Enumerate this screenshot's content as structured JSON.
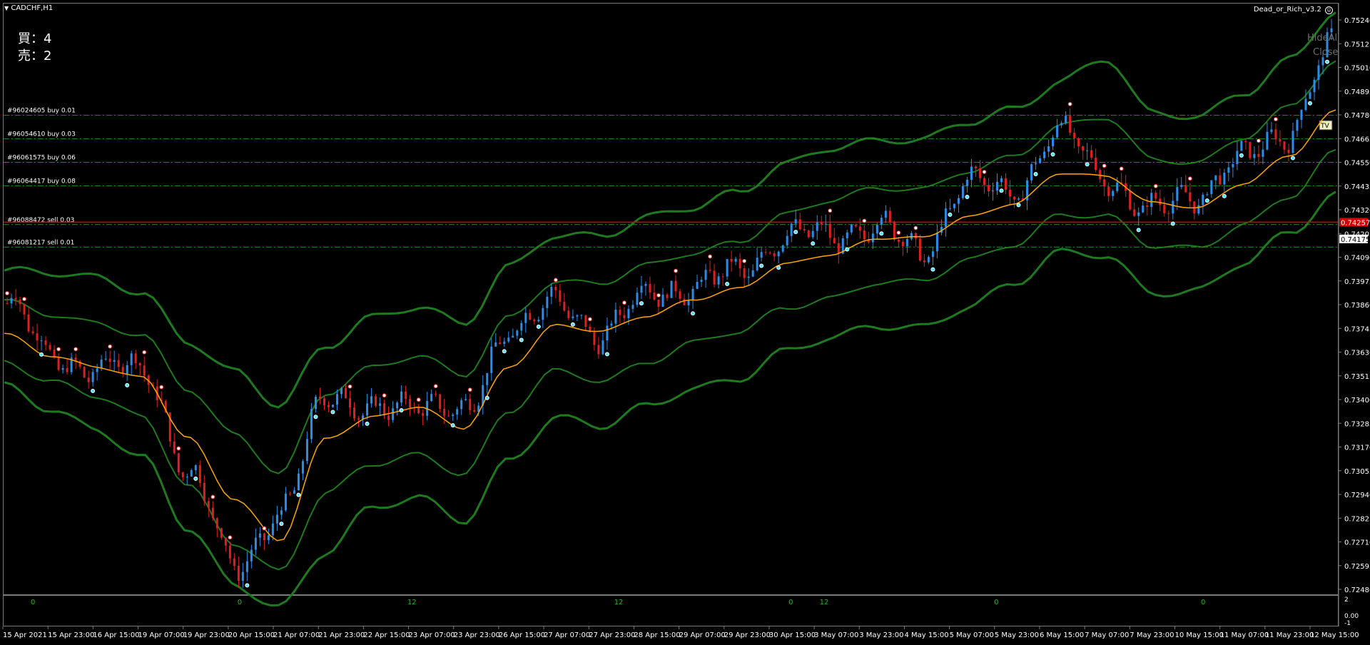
{
  "window": {
    "symbol_timeframe": "CADCHF,H1",
    "expert_name": "Dead_or_Rich_v3.2",
    "hide_button": "HideAll",
    "close_button": "Close"
  },
  "position_counts": {
    "buy_label": "買：4",
    "sell_label": "売：2"
  },
  "order_lines": [
    {
      "label": "#96024605 buy 0.01",
      "price": 0.7478,
      "color": "#1f8f1f"
    },
    {
      "label": "#96054610 buy 0.03",
      "price": 0.74665,
      "color": "#1f8f1f"
    },
    {
      "label": "#96061575 buy 0.06",
      "price": 0.7455,
      "color": "#1f8f1f"
    },
    {
      "label": "#96064417 buy 0.08",
      "price": 0.74435,
      "color": "#1f8f1f"
    },
    {
      "label": "#96088472 sell 0.03",
      "price": 0.74245,
      "color": "#1f8f1f"
    },
    {
      "label": "#96081217 sell 0.01",
      "price": 0.74135,
      "color": "#1f8f1f"
    }
  ],
  "current_price": {
    "label": "0.74257",
    "value": 0.74257,
    "color": "#d40000"
  },
  "second_price_tag": {
    "label": "0.74175",
    "value": 0.74175
  },
  "tag_box": {
    "label": "TV"
  },
  "price_axis": {
    "ticks": [
      "0.75240",
      "0.75125",
      "0.75010",
      "0.74895",
      "0.74780",
      "0.74665",
      "0.74550",
      "0.74435",
      "0.74320",
      "0.74205",
      "0.74090",
      "0.73975",
      "0.73860",
      "0.73745",
      "0.73630",
      "0.73515",
      "0.73400",
      "0.73285",
      "0.73170",
      "0.73055",
      "0.72940",
      "0.72825",
      "0.72710",
      "0.72595",
      "0.72480"
    ],
    "max": 0.7524,
    "min": 0.7248
  },
  "time_axis": {
    "labels": [
      "15 Apr 2021",
      "15 Apr 23:00",
      "16 Apr 15:00",
      "19 Apr 07:00",
      "19 Apr 23:00",
      "20 Apr 15:00",
      "21 Apr 07:00",
      "21 Apr 23:00",
      "22 Apr 15:00",
      "23 Apr 07:00",
      "23 Apr 23:00",
      "26 Apr 15:00",
      "27 Apr 07:00",
      "27 Apr 23:00",
      "28 Apr 15:00",
      "29 Apr 07:00",
      "29 Apr 23:00",
      "30 Apr 15:00",
      "3 May 07:00",
      "3 May 23:00",
      "4 May 15:00",
      "5 May 07:00",
      "5 May 23:00",
      "6 May 15:00",
      "7 May 07:00",
      "7 May 23:00",
      "10 May 15:00",
      "11 May 07:00",
      "11 May 23:00",
      "12 May 15:00"
    ]
  },
  "sub_window": {
    "axis_ticks": [
      "2",
      "0.00",
      "-1"
    ],
    "markers": [
      {
        "text": "0",
        "index": 0.022
      },
      {
        "text": "0",
        "index": 0.177
      },
      {
        "text": "12",
        "index": 0.306
      },
      {
        "text": "12",
        "index": 0.461
      },
      {
        "text": "0",
        "index": 0.59
      },
      {
        "text": "12",
        "index": 0.615
      },
      {
        "text": "0",
        "index": 0.744
      },
      {
        "text": "0",
        "index": 0.899
      }
    ],
    "marker_color": "#22b422"
  },
  "colors": {
    "background": "#000000",
    "bull_candle": "#2a8ee8",
    "bear_candle": "#e02020",
    "ma_line": "#ffa500",
    "band_line": "#1e7a1e",
    "order_line": "#1f8f1f",
    "grid_text": "#ffffff"
  },
  "chart_data": {
    "type": "line",
    "title": "CADCHF,H1",
    "xlabel": "",
    "ylabel": "",
    "ylim": [
      0.7248,
      0.7524
    ],
    "x": [
      "15 Apr 2021",
      "15 Apr 23:00",
      "16 Apr 15:00",
      "19 Apr 07:00",
      "19 Apr 23:00",
      "20 Apr 15:00",
      "21 Apr 07:00",
      "21 Apr 23:00",
      "22 Apr 15:00",
      "23 Apr 07:00",
      "23 Apr 23:00",
      "26 Apr 15:00",
      "27 Apr 07:00",
      "27 Apr 23:00",
      "28 Apr 15:00",
      "29 Apr 07:00",
      "29 Apr 23:00",
      "30 Apr 15:00",
      "3 May 07:00",
      "3 May 23:00",
      "4 May 15:00",
      "5 May 07:00",
      "5 May 23:00",
      "6 May 15:00",
      "7 May 07:00",
      "7 May 23:00",
      "10 May 15:00",
      "11 May 07:00",
      "11 May 23:00",
      "12 May 15:00"
    ],
    "series": [
      {
        "values": [
          0.7386,
          0.736,
          0.7353,
          0.7355,
          0.73,
          0.726,
          0.728,
          0.7345,
          0.733,
          0.734,
          0.733,
          0.7375,
          0.7385,
          0.7372,
          0.739,
          0.7395,
          0.74,
          0.742,
          0.7418,
          0.7425,
          0.741,
          0.7445,
          0.744,
          0.747,
          0.745,
          0.743,
          0.744,
          0.7455,
          0.747,
          0.751
        ]
      },
      {
        "values": [
          0.7371,
          0.736,
          0.7355,
          0.735,
          0.732,
          0.729,
          0.727,
          0.732,
          0.733,
          0.7335,
          0.7325,
          0.7355,
          0.7375,
          0.7372,
          0.738,
          0.7388,
          0.7393,
          0.7405,
          0.741,
          0.7418,
          0.7418,
          0.7428,
          0.7435,
          0.745,
          0.7448,
          0.7435,
          0.7433,
          0.7445,
          0.7458,
          0.748
        ]
      },
      {
        "values": [
          0.7402,
          0.74,
          0.7398,
          0.7392,
          0.7368,
          0.7352,
          0.7335,
          0.7365,
          0.738,
          0.7385,
          0.7375,
          0.7403,
          0.742,
          0.742,
          0.7428,
          0.7432,
          0.744,
          0.7455,
          0.7463,
          0.7465,
          0.7465,
          0.7475,
          0.7482,
          0.7495,
          0.7505,
          0.7478,
          0.7478,
          0.749,
          0.7505,
          0.7528
        ]
      },
      {
        "values": [
          0.7345,
          0.7335,
          0.7325,
          0.731,
          0.7275,
          0.7248,
          0.7238,
          0.7265,
          0.7285,
          0.729,
          0.728,
          0.731,
          0.733,
          0.7325,
          0.7335,
          0.7345,
          0.735,
          0.7362,
          0.7368,
          0.7375,
          0.7375,
          0.7385,
          0.7395,
          0.741,
          0.741,
          0.7392,
          0.7392,
          0.7405,
          0.742,
          0.744
        ]
      }
    ]
  }
}
